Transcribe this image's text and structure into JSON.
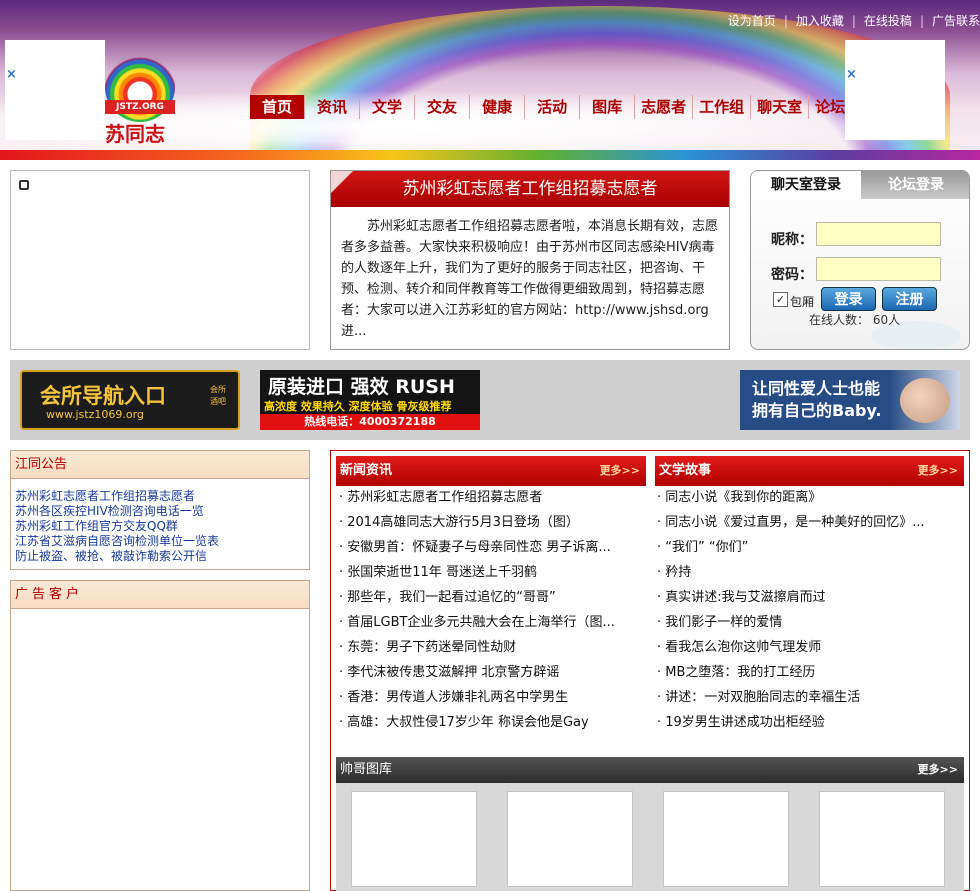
{
  "toplinks": [
    "设为首页",
    "加入收藏",
    "在线投稿",
    "广告联系"
  ],
  "ad_close": "×",
  "logo": {
    "bar": "JSTZ.ORG",
    "text": "苏同志"
  },
  "nav": [
    "首页",
    "资讯",
    "文学",
    "交友",
    "健康",
    "活动",
    "图库",
    "志愿者",
    "工作组",
    "聊天室",
    "论坛"
  ],
  "news_feature": {
    "title": "苏州彩虹志愿者工作组招募志愿者",
    "body": "苏州彩虹志愿者工作组招募志愿者啦，本消息长期有效，志愿者多多益善。大家快来积极响应！由于苏州市区同志感染HIV病毒的人数逐年上升，我们为了更好的服务于同志社区，把咨询、干预、检测、转介和同伴教育等工作做得更细致周到，特招募志愿者：大家可以进入江苏彩虹的官方网站：http://www.jshsd.org进..."
  },
  "login": {
    "tab_chat": "聊天室登录",
    "tab_forum": "论坛登录",
    "nickname_label": "昵称：",
    "password_label": "密码：",
    "nickname_value": "",
    "password_value": "",
    "check_mark": "✓",
    "check_label": "包厢",
    "login_button": "登录",
    "register_button": "注册",
    "online": "在线人数： 60人"
  },
  "banners": {
    "b1": {
      "title": "会所导航入口",
      "url": "www.jstz1069.org",
      "side": "会所酒吧"
    },
    "b2": {
      "title": "原装进口 强效 RUSH",
      "slogan": "高浓度 效果持久 深度体验 骨灰级推荐",
      "phone": "热线电话：4000372188"
    },
    "b3": {
      "line1": "让同性爱人士也能",
      "line2": "拥有自己的Baby."
    }
  },
  "notice": {
    "title": "江同公告",
    "items": [
      "苏州彩虹志愿者工作组招募志愿者",
      "苏州各区疾控HIV检测咨询电话一览",
      "苏州彩虹工作组官方交友QQ群",
      "江苏省艾滋病自愿咨询检测单位一览表",
      "防止被盗、被抢、被敲诈勒索公开信"
    ]
  },
  "ad_clients": {
    "title": "广告客户"
  },
  "news": {
    "title": "新闻资讯",
    "more": "更多>>",
    "items": [
      "· 苏州彩虹志愿者工作组招募志愿者",
      "· 2014高雄同志大游行5月3日登场（图）",
      "· 安徽男首：怀疑妻子与母亲同性恋 男子诉离...",
      "· 张国荣逝世11年 哥迷送上千羽鹤",
      "· 那些年，我们一起看过追忆的“哥哥”",
      "· 首届LGBT企业多元共融大会在上海举行（图...",
      "· 东莞：男子下药迷晕同性劫财",
      "· 李代沫被传患艾滋解押 北京警方辟谣",
      "· 香港：男传道人涉嫌非礼两名中学男生",
      "· 高雄：大叔性侵17岁少年 称误会他是Gay"
    ]
  },
  "literature": {
    "title": "文学故事",
    "more": "更多>>",
    "items": [
      "· 同志小说《我到你的距离》",
      "· 同志小说《爱过直男，是一种美好的回忆》...",
      "· “我们” “你们”",
      "· 矜持",
      "· 真实讲述:我与艾滋擦肩而过",
      "· 我们影子一样的爱情",
      "· 看我怎么泡你这帅气理发师",
      "· MB之堕落：我的打工经历",
      "· 讲述：一对双胞胎同志的幸福生活",
      "· 19岁男生讲述成功出柜经验"
    ]
  },
  "gallery": {
    "title": "帅哥图库",
    "more": "更多>>",
    "count": 4
  }
}
